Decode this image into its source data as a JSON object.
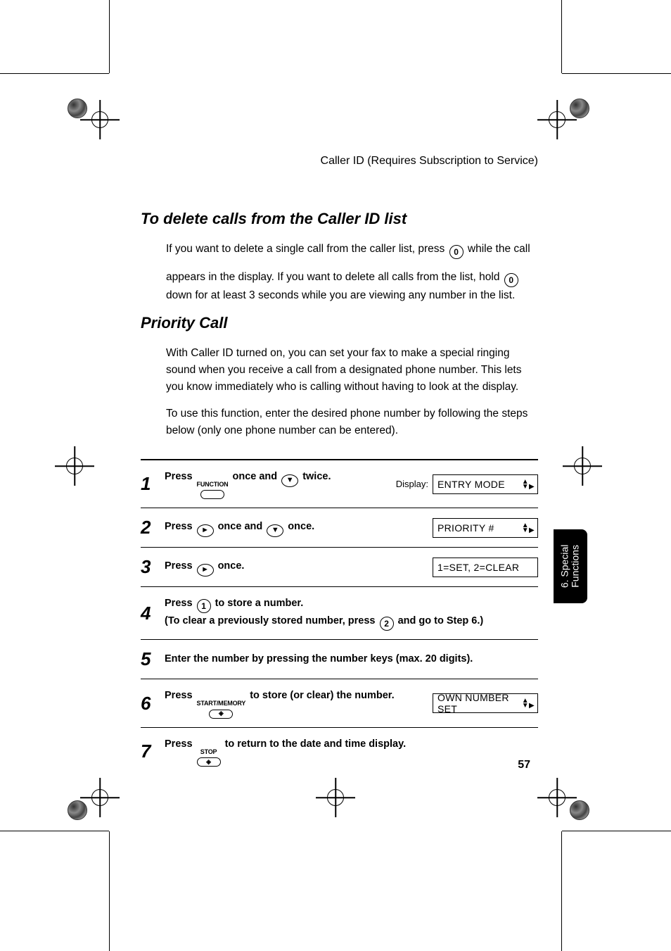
{
  "header": "Caller ID (Requires Subscription to Service)",
  "section1": {
    "heading": "To delete calls from the Caller ID list",
    "para_a1": "If you want to delete a single call from the caller list, press ",
    "key_a": "0",
    "para_a2": " while the call",
    "para_b": "appears in the display. If you want to delete all calls from the list, hold ",
    "key_b": "0",
    "para_c": "down for at least 3 seconds while you are viewing any number in the list."
  },
  "section2": {
    "heading": "Priority Call",
    "p1": "With Caller ID turned on, you can set your fax to make a special ringing sound when you receive a call from a designated phone number. This lets you know immediately who is calling without having to look at the display.",
    "p2": "To use this function, enter the desired phone number by following the steps below (only one phone number can be entered)."
  },
  "steps": [
    {
      "n": "1",
      "lead": "Press ",
      "key_label": "FUNCTION",
      "mid1": " once and ",
      "arrow_glyph": "▼",
      "tail": " twice.",
      "display_label": "Display:",
      "lcd": "ENTRY MODE",
      "lcd_has_arrows": true
    },
    {
      "n": "2",
      "lead": "Press ",
      "arrow1": "►",
      "mid1": " once and ",
      "arrow2": "▼",
      "tail": " once.",
      "lcd": "PRIORITY #",
      "lcd_has_arrows": true
    },
    {
      "n": "3",
      "lead": "Press ",
      "arrow1": "►",
      "tail": " once.",
      "lcd": "1=SET, 2=CLEAR"
    },
    {
      "n": "4",
      "lead": "Press ",
      "key_circle": "1",
      "tail": " to store a number.",
      "line2a": "(To clear a previously stored number, press ",
      "key_circle2": "2",
      "line2b": " and go to Step 6.)"
    },
    {
      "n": "5",
      "full": "Enter the number by pressing the number keys (max. 20 digits)."
    },
    {
      "n": "6",
      "lead": "Press ",
      "key_label": "START/MEMORY",
      "tail": " to store (or clear) the number.",
      "lcd": "OWN NUMBER SET",
      "lcd_has_arrows": true
    },
    {
      "n": "7",
      "lead": "Press ",
      "key_label": "STOP",
      "tail": " to return to the date and time display."
    }
  ],
  "tab": {
    "line1": "6. Special",
    "line2": "Functions"
  },
  "page_number": "57"
}
